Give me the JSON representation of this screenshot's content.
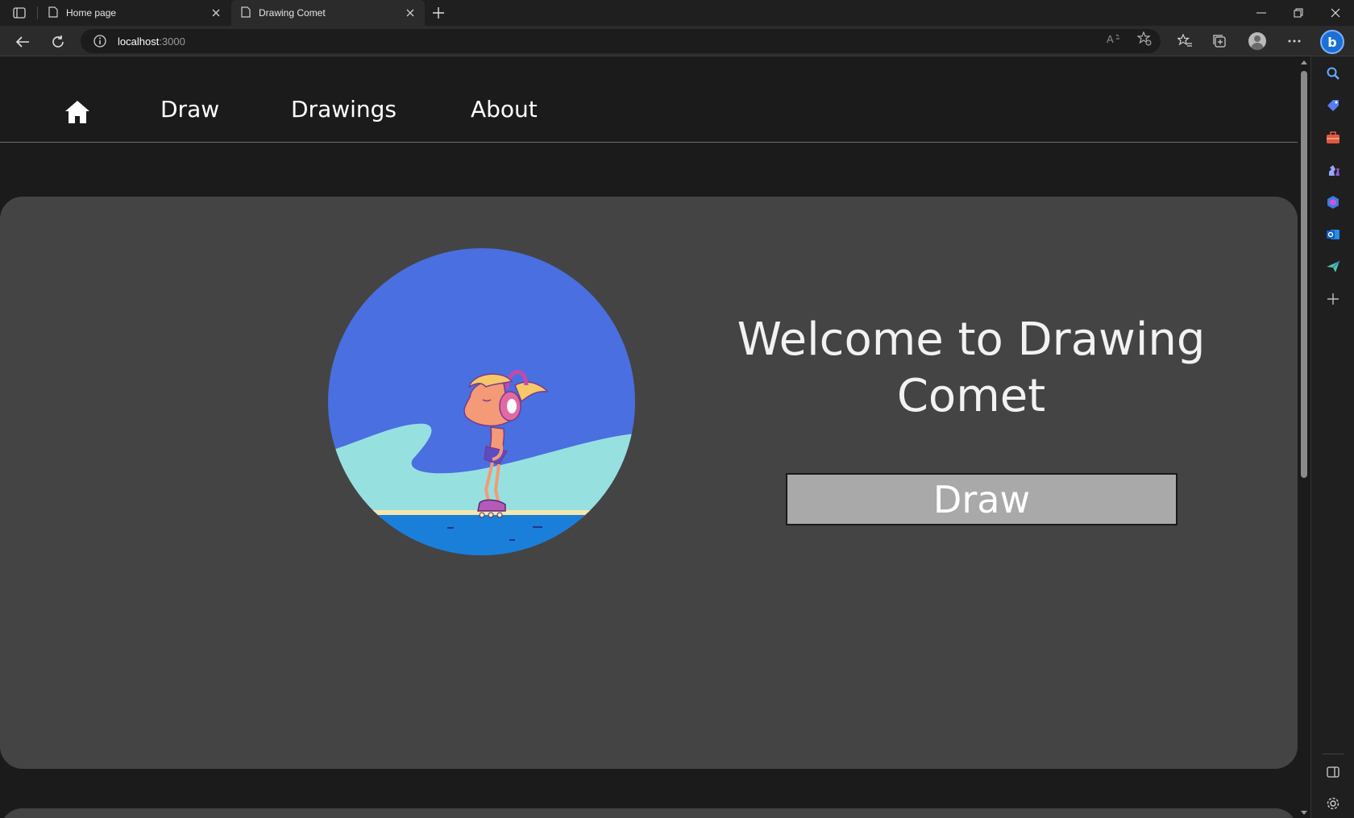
{
  "browser": {
    "tabs": [
      {
        "title": "Home page",
        "active": false
      },
      {
        "title": "Drawing Comet",
        "active": true
      }
    ],
    "url_host": "localhost",
    "url_port": ":3000"
  },
  "nav": {
    "home_icon": "home-icon",
    "links": [
      "Draw",
      "Drawings",
      "About"
    ]
  },
  "hero": {
    "title": "Welcome to Drawing Comet",
    "button_label": "Draw",
    "image_icon": "roller-skater-illustration"
  },
  "colors": {
    "page_bg": "#1b1b1b",
    "card_bg": "#444444",
    "button_bg": "#a9a9a9",
    "sky": "#4a6fe0",
    "wave": "#97e0e0",
    "water": "#1a7fd9"
  },
  "sidebar_icons": [
    "search-icon",
    "tag-icon",
    "briefcase-icon",
    "chess-icon",
    "m365-icon",
    "outlook-icon",
    "send-icon",
    "add-icon",
    "sidebar-toggle-icon",
    "settings-icon"
  ]
}
